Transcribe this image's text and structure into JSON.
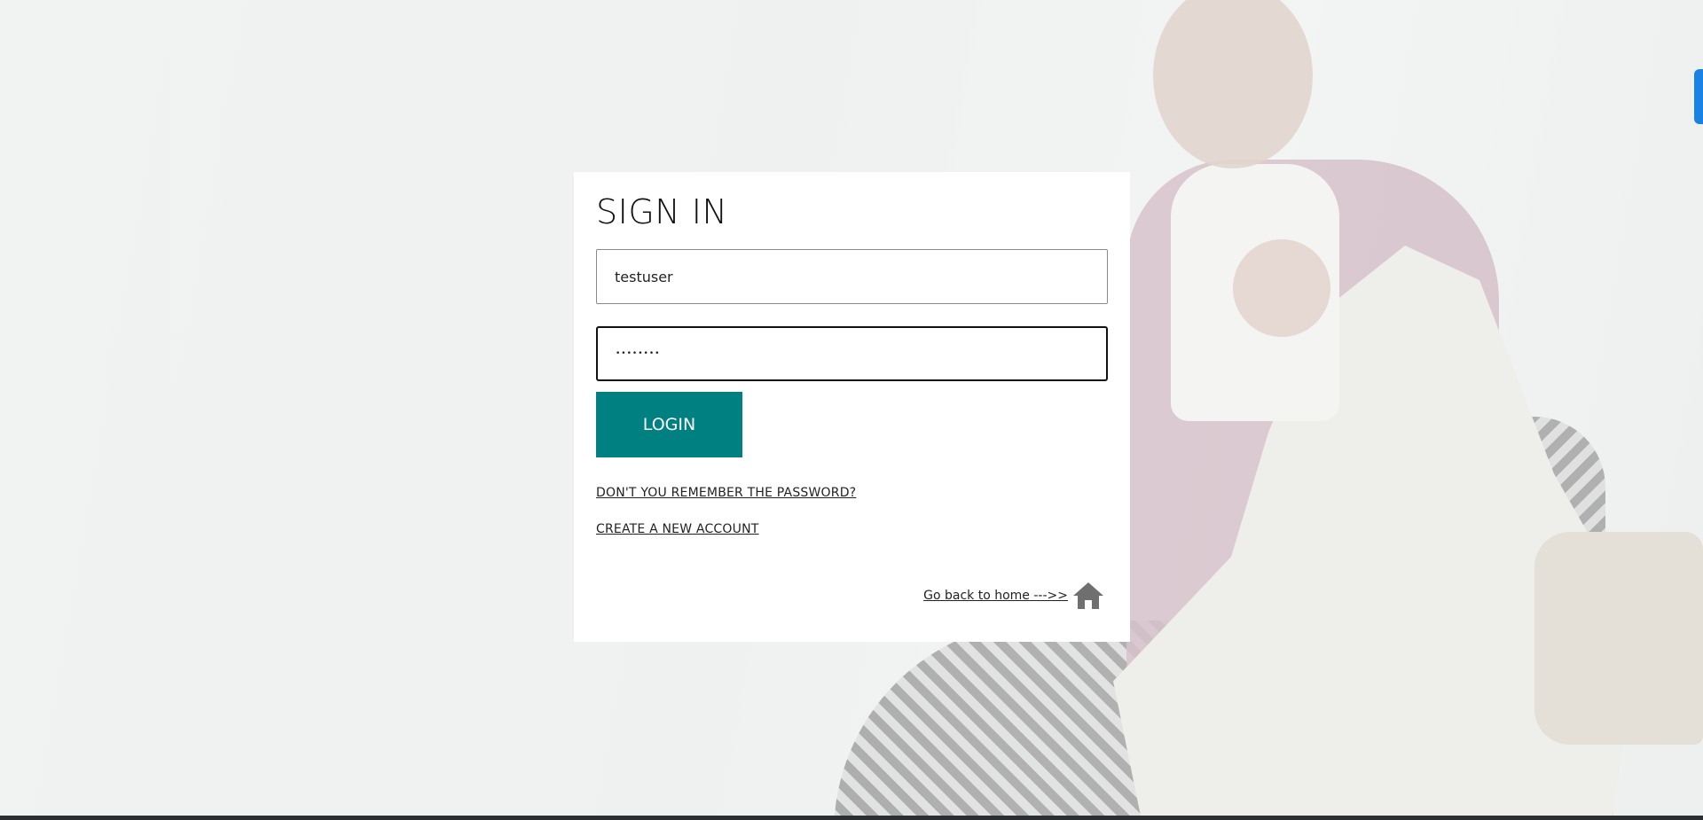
{
  "login": {
    "title": "SIGN IN",
    "username_value": "testuser",
    "password_value": "••••••••",
    "login_button": "LOGIN",
    "forgot_link": "DON'T YOU REMEMBER THE PASSWORD?",
    "create_link": "CREATE A NEW ACCOUNT",
    "home_link": "Go back to home --->> ",
    "home_icon": "home-icon"
  },
  "colors": {
    "primary_button": "#008080",
    "card_background": "#ffffff",
    "side_tab": "#1a82e2"
  }
}
